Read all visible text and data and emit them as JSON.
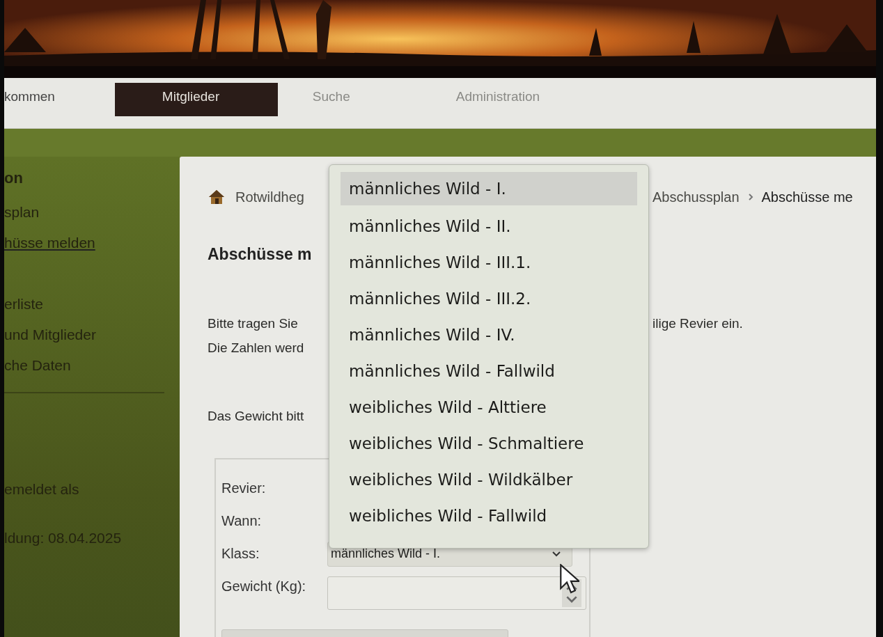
{
  "nav": {
    "tabs": [
      {
        "label": "kommen",
        "selected": false
      },
      {
        "label": "Mitglieder",
        "selected": true
      },
      {
        "label": "Suche",
        "selected": false
      },
      {
        "label": "Administration",
        "selected": false
      }
    ]
  },
  "sidebar": {
    "heading": "on",
    "items": [
      {
        "label": "splan",
        "selected": false
      },
      {
        "label": "hüsse melden",
        "selected": true
      },
      {
        "label": "erliste",
        "selected": false
      },
      {
        "label": "und Mitglieder",
        "selected": false
      },
      {
        "label": "che Daten",
        "selected": false
      }
    ],
    "login_label": "emeldet als",
    "login_date": "ldung: 08.04.2025"
  },
  "content": {
    "breadcrumb_left": "Rotwildheg",
    "breadcrumb_right": [
      "Abschussplan",
      "Abschüsse me"
    ],
    "title": "Abschüsse m",
    "intro": [
      {
        "left": "Bitte tragen Sie",
        "right": "ilige Revier ein."
      },
      {
        "left": "Die Zahlen werd"
      }
    ],
    "weight_note": "Das Gewicht bitt",
    "form": {
      "fields": [
        {
          "label": "Revier:",
          "kind": "covered"
        },
        {
          "label": "Wann:",
          "kind": "covered"
        },
        {
          "label": "Klass:",
          "kind": "select",
          "value": "männliches Wild - I."
        },
        {
          "label": "Gewicht (Kg):",
          "kind": "number"
        },
        {
          "kind": "bar"
        }
      ]
    }
  },
  "dropdown": {
    "options": [
      {
        "label": "männliches Wild - I.",
        "selected": true
      },
      {
        "label": "männliches Wild - II.",
        "selected": false
      },
      {
        "label": "männliches Wild - III.1.",
        "selected": false
      },
      {
        "label": "männliches Wild - III.2.",
        "selected": false
      },
      {
        "label": "männliches Wild - IV.",
        "selected": false
      },
      {
        "label": "männliches Wild - Fallwild",
        "selected": false
      },
      {
        "label": "weibliches Wild - Alttiere",
        "selected": false
      },
      {
        "label": "weibliches Wild - Schmaltiere",
        "selected": false
      },
      {
        "label": "weibliches Wild - Wildkälber",
        "selected": false
      },
      {
        "label": "weibliches Wild - Fallwild",
        "selected": false
      }
    ]
  }
}
